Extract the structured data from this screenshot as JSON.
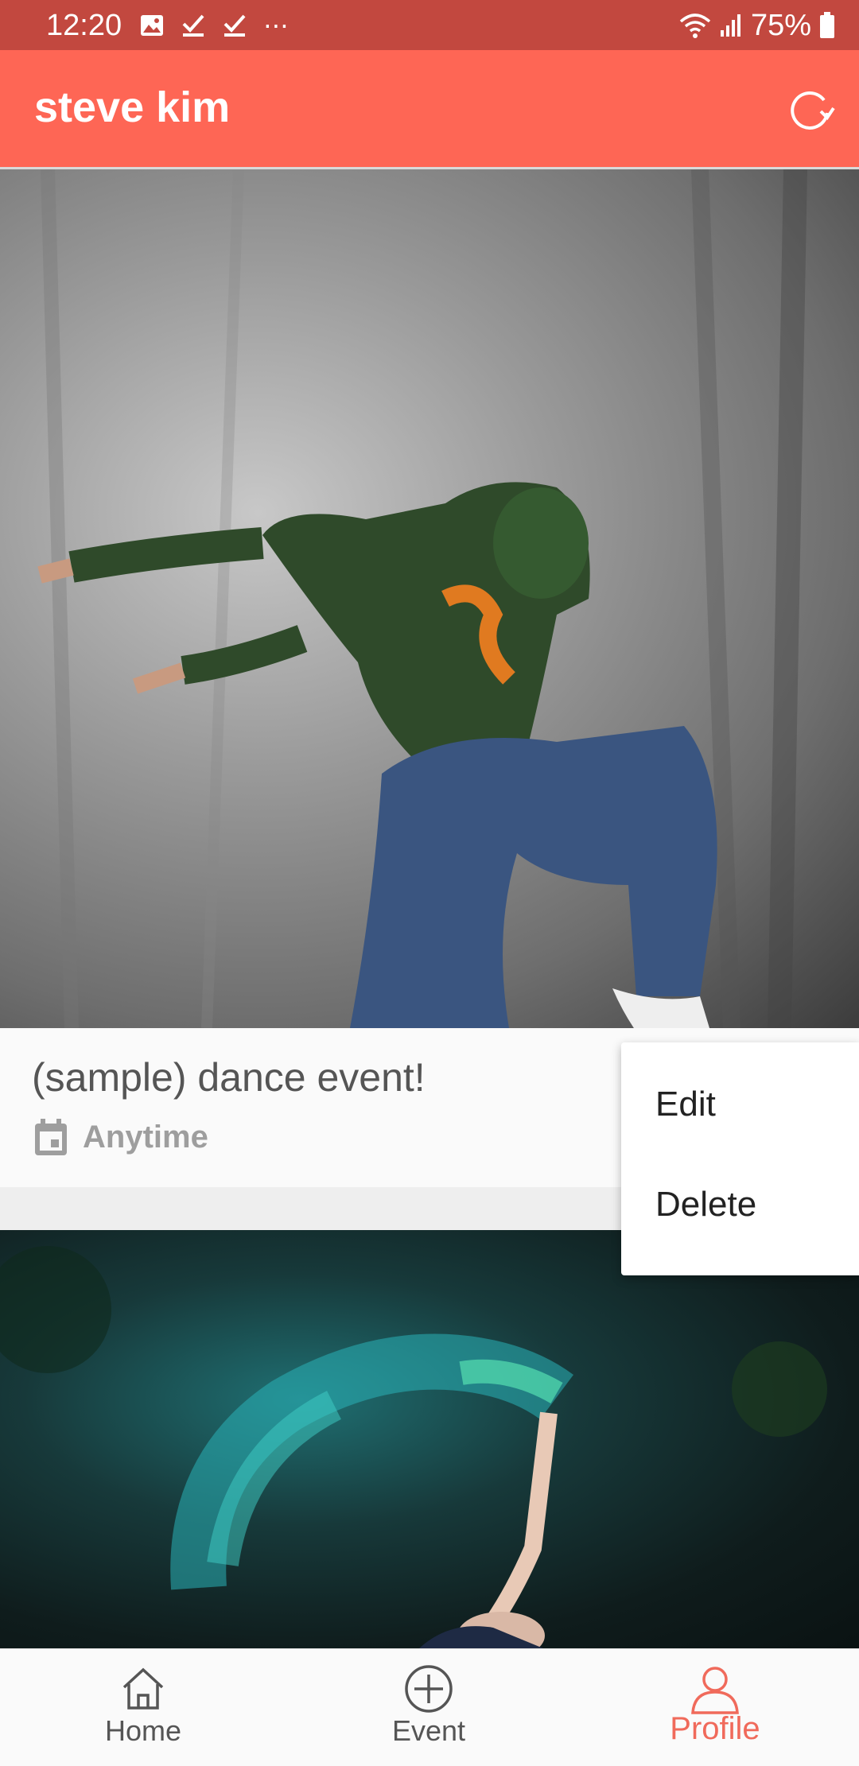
{
  "status_bar": {
    "time": "12:20",
    "battery": "75%",
    "left_icons": [
      "image-icon",
      "check-icon",
      "check-icon",
      "more-icon"
    ],
    "right_icons": [
      "wifi-icon",
      "signal-icon",
      "battery-icon"
    ]
  },
  "app_bar": {
    "title": "steve kim",
    "refresh_icon": "refresh-icon"
  },
  "feed": {
    "items": [
      {
        "title": "(sample) dance event!",
        "date": "Anytime",
        "image": "dancer-jump-photo"
      },
      {
        "image": "powder-dancer-photo"
      }
    ]
  },
  "popup_menu": {
    "items": [
      "Edit",
      "Delete"
    ]
  },
  "bottom_nav": {
    "items": [
      {
        "label": "Home",
        "icon": "home-icon",
        "active": false
      },
      {
        "label": "Event",
        "icon": "add-circle-icon",
        "active": false
      },
      {
        "label": "Profile",
        "icon": "person-icon",
        "active": true
      }
    ]
  },
  "colors": {
    "status_bar": "#c2483f",
    "app_bar": "#fe6655",
    "accent": "#f06a5b"
  }
}
